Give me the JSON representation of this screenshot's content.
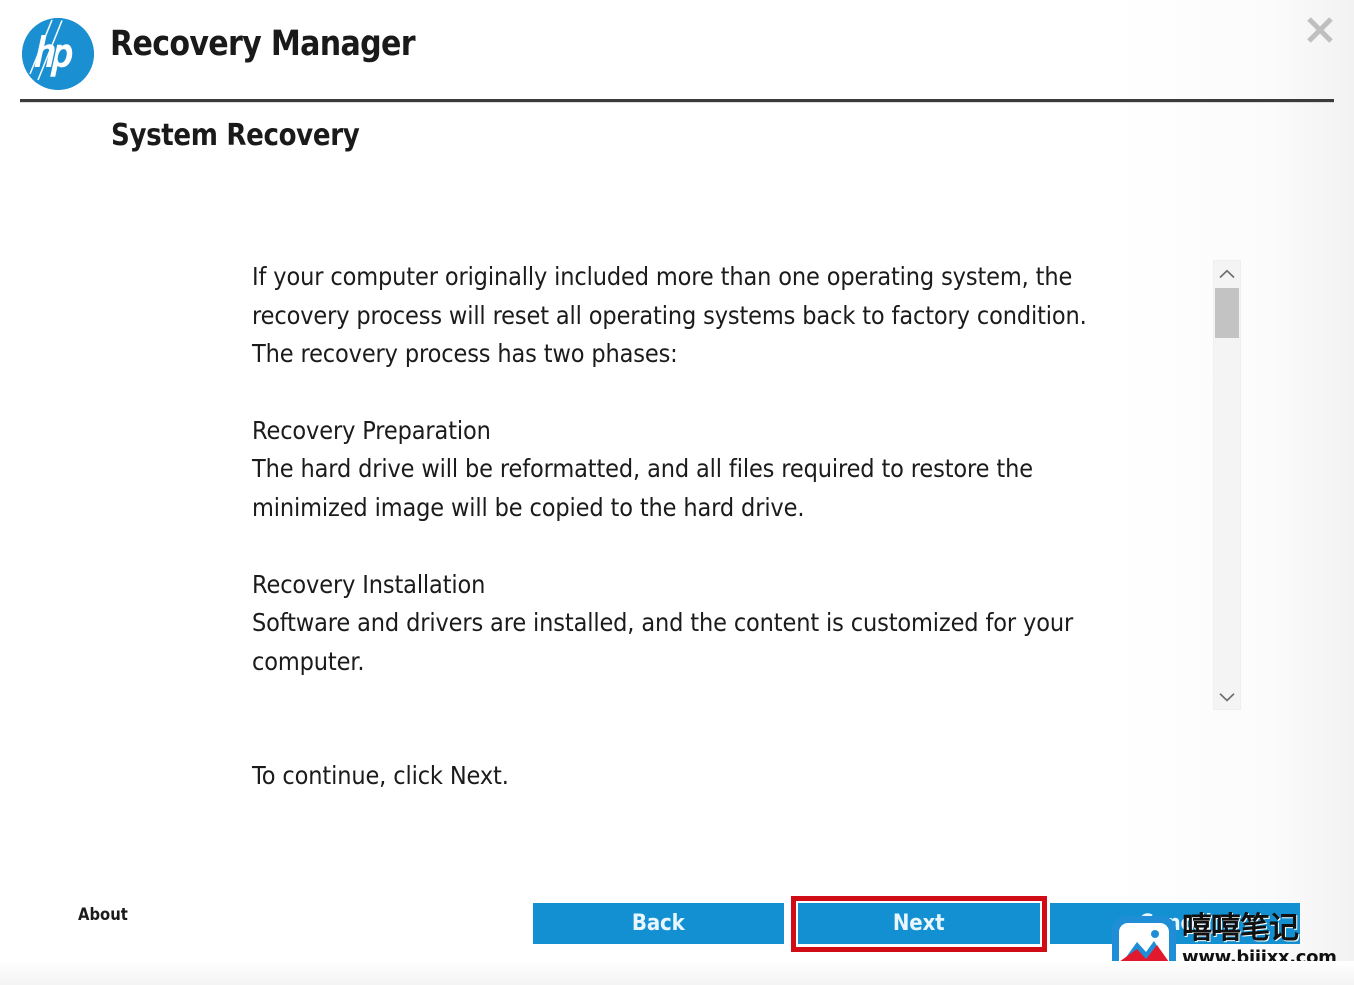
{
  "window": {
    "app_title": "Recovery Manager",
    "close_label": "✕",
    "logo_text": "hp"
  },
  "page": {
    "title": "System Recovery"
  },
  "content": {
    "paragraphs": [
      "If your computer originally included more than one operating system, the recovery process will reset all operating systems back to factory condition. The recovery process has two phases:",
      "Recovery Preparation",
      "The hard drive will be reformatted, and all files required to restore the minimized image will be copied to the hard drive.",
      "Recovery Installation",
      "Software and drivers are installed, and the content is customized for your computer.",
      "To continue, click Next."
    ],
    "intro": "If your computer originally included more than one operating system, the recovery process will reset all operating systems back to factory condition. The recovery process has two phases:",
    "phase1_heading": "Recovery Preparation",
    "phase1_body": "The hard drive will be reformatted, and all files required to restore the minimized image will be copied to the hard drive.",
    "phase2_heading": "Recovery Installation",
    "phase2_body": "Software and drivers are installed, and the content is customized for your computer.",
    "continue_note": "To continue, click Next."
  },
  "scrollbar": {
    "up_arrow": "▲",
    "down_arrow": "▼",
    "thumb_position_percent": 4
  },
  "footer": {
    "about_label": "About",
    "back_label": "Back",
    "next_label": "Next",
    "cancel_label": "Cancel"
  },
  "watermark": {
    "brand_cn": "嘻嘻笔记",
    "url": "www.bijixx.com"
  },
  "colors": {
    "hp_blue": "#1a8fd1",
    "button_blue": "#1390d2",
    "highlight_red": "#d00d17",
    "text_black": "#1b1b1b",
    "scrollbar_thumb": "#c3c3c3",
    "background": "#ffffff"
  }
}
